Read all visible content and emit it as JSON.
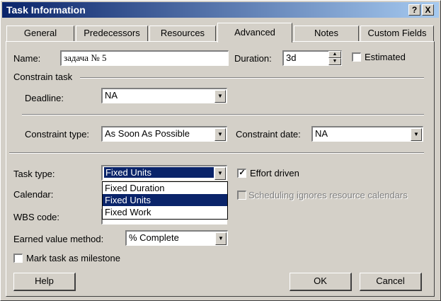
{
  "window": {
    "title": "Task Information",
    "help_glyph": "?",
    "close_glyph": "X"
  },
  "tabs": [
    "General",
    "Predecessors",
    "Resources",
    "Advanced",
    "Notes",
    "Custom Fields"
  ],
  "active_tab": "Advanced",
  "name": {
    "label": "Name:",
    "value": "задача № 5"
  },
  "duration": {
    "label": "Duration:",
    "value": "3d"
  },
  "estimated": {
    "label": "Estimated",
    "checked": false
  },
  "constrain_task": {
    "group_label": "Constrain task"
  },
  "deadline": {
    "label": "Deadline:",
    "value": "NA"
  },
  "constraint_type": {
    "label": "Constraint type:",
    "value": "As Soon As Possible"
  },
  "constraint_date": {
    "label": "Constraint date:",
    "value": "NA"
  },
  "task_type": {
    "label": "Task type:",
    "value": "Fixed Units",
    "options": [
      "Fixed Duration",
      "Fixed Units",
      "Fixed Work"
    ],
    "selected": "Fixed Units"
  },
  "effort_driven": {
    "label": "Effort driven",
    "checked": true
  },
  "calendar": {
    "label": "Calendar:"
  },
  "scheduling_ignores": {
    "label": "Scheduling ignores resource calendars",
    "checked": false,
    "enabled": false
  },
  "wbs_code": {
    "label": "WBS code:"
  },
  "earned_value": {
    "label": "Earned value method:",
    "value": "% Complete"
  },
  "milestone": {
    "label": "Mark task as milestone",
    "checked": false
  },
  "buttons": {
    "help": "Help",
    "ok": "OK",
    "cancel": "Cancel"
  },
  "colors": {
    "title_bar": "#0a246a",
    "selection": "#0a246a",
    "face": "#d4d0c8"
  }
}
